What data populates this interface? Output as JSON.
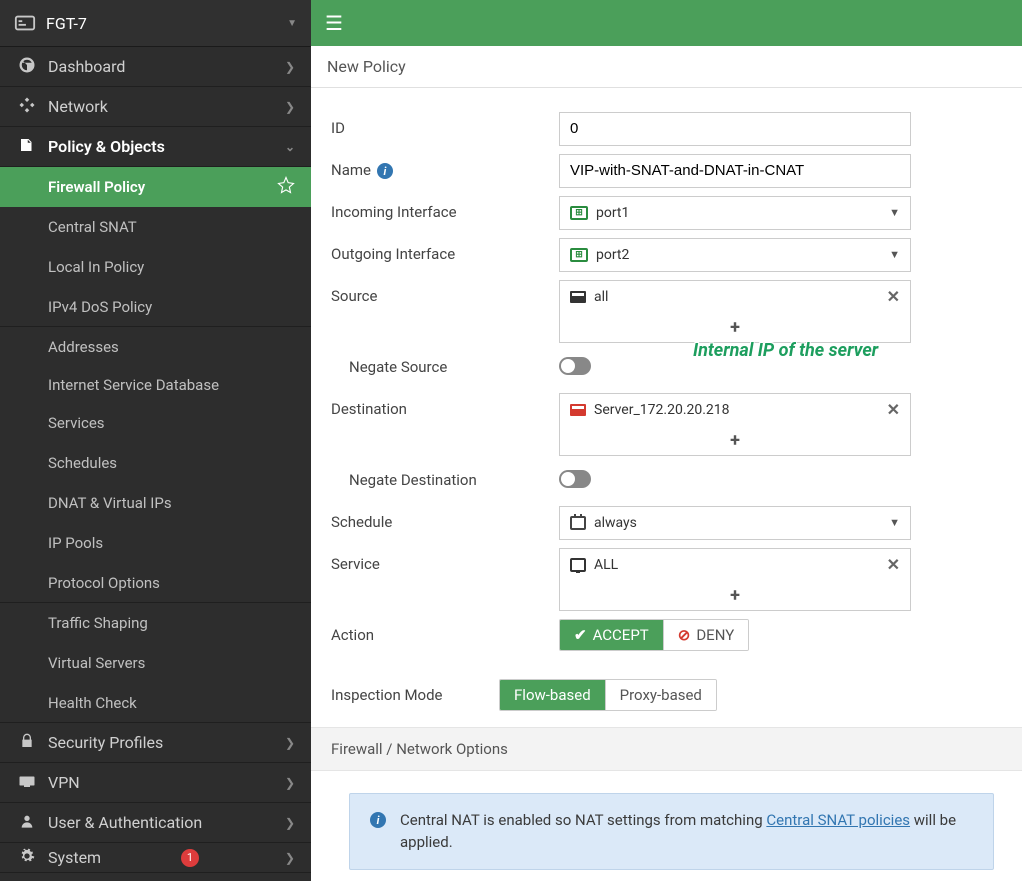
{
  "device_name": "FGT-7",
  "nav": {
    "dashboard": "Dashboard",
    "network": "Network",
    "policy_objects": "Policy & Objects",
    "security_profiles": "Security Profiles",
    "vpn": "VPN",
    "user_auth": "User & Authentication",
    "system": "System",
    "system_badge": "1",
    "children": {
      "firewall_policy": "Firewall Policy",
      "central_snat": "Central SNAT",
      "local_in_policy": "Local In Policy",
      "ipv4_dos_policy": "IPv4 DoS Policy",
      "addresses": "Addresses",
      "internet_service_db": "Internet Service Database",
      "services": "Services",
      "schedules": "Schedules",
      "dnat_vips": "DNAT & Virtual IPs",
      "ip_pools": "IP Pools",
      "protocol_options": "Protocol Options",
      "traffic_shaping": "Traffic Shaping",
      "virtual_servers": "Virtual Servers",
      "health_check": "Health Check"
    }
  },
  "page": {
    "title": "New Policy",
    "labels": {
      "id": "ID",
      "name": "Name",
      "incoming_if": "Incoming Interface",
      "outgoing_if": "Outgoing Interface",
      "source": "Source",
      "negate_source": "Negate Source",
      "destination": "Destination",
      "negate_destination": "Negate Destination",
      "schedule": "Schedule",
      "service": "Service",
      "action": "Action",
      "inspection_mode": "Inspection Mode",
      "section_firewall_network": "Firewall / Network Options"
    },
    "values": {
      "id": "0",
      "name": "VIP-with-SNAT-and-DNAT-in-CNAT",
      "incoming_if": "port1",
      "outgoing_if": "port2",
      "source": "all",
      "destination": "Server_172.20.20.218",
      "schedule": "always",
      "service": "ALL"
    },
    "actions": {
      "accept": "ACCEPT",
      "deny": "DENY"
    },
    "inspection": {
      "flow": "Flow-based",
      "proxy": "Proxy-based"
    },
    "info_box": {
      "text_prefix": "Central NAT is enabled so NAT settings from matching ",
      "link_text": "Central SNAT policies",
      "text_suffix": " will be applied."
    },
    "annotation": "Internal IP of the server"
  }
}
